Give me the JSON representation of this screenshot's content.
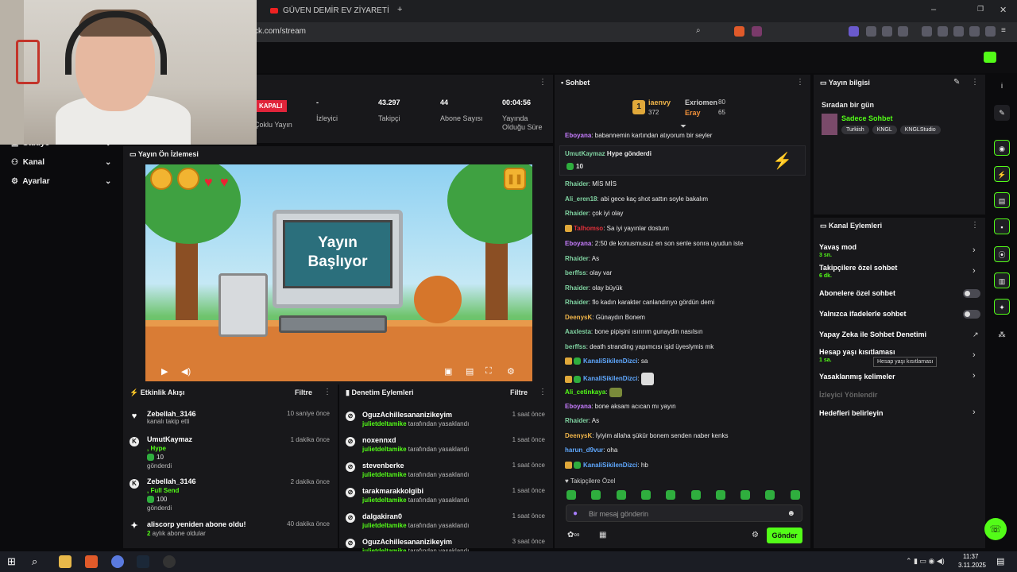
{
  "browser": {
    "tab_title": "GÜVEN DEMİR EV ZİYARETİ - YouTub",
    "new_tab": "+",
    "url": "ck.com/stream",
    "win_min": "–",
    "win_max": "❐",
    "win_close": "✕"
  },
  "nav": {
    "studio": "Stüdyo",
    "kanal": "Kanal",
    "ayarlar": "Ayarlar"
  },
  "stats": {
    "badge": "KAPALI",
    "items": [
      {
        "value": "",
        "label": "Çoklu Yayın"
      },
      {
        "value": "-",
        "label": "İzleyici"
      },
      {
        "value": "43.297",
        "label": "Takipçi"
      },
      {
        "value": "44",
        "label": "Abone Sayısı"
      },
      {
        "value": "00:04:56",
        "label": "Yayında Olduğu Süre"
      }
    ]
  },
  "preview": {
    "title": "Yayın Ön İzlemesi",
    "screen_text_1": "Yayın",
    "screen_text_2": "Başlıyor"
  },
  "activity": {
    "title": "Etkinlik Akışı",
    "filter": "Filtre",
    "rows": [
      {
        "name": "Zebellah_3146",
        "time": "10 saniye önce",
        "sub": "kanalı takip etti"
      },
      {
        "name": "UmutKaymaz",
        "time": "1 dakika önce",
        "extra": ", Hype",
        "amount": "10",
        "sub": "gönderdi"
      },
      {
        "name": "Zebellah_3146",
        "time": "2 dakika önce",
        "extra": ", Full Send",
        "amount": "100",
        "sub": "gönderdi"
      },
      {
        "name": "aliscorp yeniden abone oldu!",
        "time": "40 dakika önce",
        "sub_num": "2",
        "sub": " aylık abone oldular"
      }
    ]
  },
  "moderation": {
    "title": "Denetim Eylemleri",
    "filter": "Filtre",
    "by": "julietdeltamike",
    "action": " tarafından yasaklandı",
    "rows": [
      {
        "name": "OguzAchillesananizikeyim",
        "time": "1 saat önce"
      },
      {
        "name": "noxennxd",
        "time": "1 saat önce"
      },
      {
        "name": "stevenberke",
        "time": "1 saat önce"
      },
      {
        "name": "tarakmarakkolgibi",
        "time": "1 saat önce"
      },
      {
        "name": "dalgakiran0",
        "time": "1 saat önce"
      },
      {
        "name": "OguzAchillesananizikeyim",
        "time": "3 saat önce"
      }
    ]
  },
  "chat": {
    "title": "Sohbet",
    "leader_rank": "1",
    "leader_name": "iaenvy",
    "leader_pts": "372",
    "second_name": "Exriomen",
    "second_pts": "80",
    "third_name": "Eray",
    "third_pts": "65",
    "hype_user": "UmutKaymaz",
    "hype_text": " Hype gönderdi",
    "hype_amount": "10",
    "messages": [
      {
        "user": "Eboyana",
        "color": "#c77dff",
        "text": ": babannemin kartından atıyorum bir seyler"
      },
      {
        "user": "Rhaider",
        "color": "#7fd1a0",
        "text": ": MİS MİS"
      },
      {
        "user": "Ali_eren18",
        "color": "#7fd1a0",
        "text": ": abi gece kaç shot sattın soyle bakalım"
      },
      {
        "user": "Rhaider",
        "color": "#7fd1a0",
        "text": ": çok iyi olay"
      },
      {
        "user": "Talhomso",
        "color": "#e0303a",
        "text": ": Sa iyi yayınlar dostum"
      },
      {
        "user": "Eboyana",
        "color": "#c77dff",
        "text": ": 2:50 de konusmusuz en son senle sonra uyudun iste"
      },
      {
        "user": "Rhaider",
        "color": "#7fd1a0",
        "text": ": As"
      },
      {
        "user": "berffss",
        "color": "#7fd1a0",
        "text": ": olay var"
      },
      {
        "user": "Rhaider",
        "color": "#7fd1a0",
        "text": ": olay büyük"
      },
      {
        "user": "Rhaider",
        "color": "#7fd1a0",
        "text": ": flo kadın karakter canlandırıyo gördün demi"
      },
      {
        "user": "DeenysK",
        "color": "#f0b54a",
        "text": ": Günaydın Bonem"
      },
      {
        "user": "Aaxlesta",
        "color": "#7fd1a0",
        "text": ": bone pipişini ısırırım gunaydin nasılsın"
      },
      {
        "user": "berffss",
        "color": "#7fd1a0",
        "text": ": death stranding yapımcısı işid üyeslymis mk"
      },
      {
        "user": "KanaliSikilenDizci",
        "color": "#5fa8ff",
        "text": ": sa"
      },
      {
        "user": "KanaliSikilenDizci",
        "color": "#5fa8ff",
        "text": ":"
      },
      {
        "user": "Ali_cetinkaya",
        "color": "#53fc18",
        "text": ":"
      },
      {
        "user": "Eboyana",
        "color": "#c77dff",
        "text": ": bone aksam acıcan mı yayın"
      },
      {
        "user": "Rhaider",
        "color": "#7fd1a0",
        "text": ": As"
      },
      {
        "user": "DeenysK",
        "color": "#f0b54a",
        "text": ": İyiyim allaha şükür bonem senden naber kenks"
      },
      {
        "user": "harun_d9vur",
        "color": "#5fa8ff",
        "text": ": oha"
      },
      {
        "user": "KanaliSikilenDizci",
        "color": "#5fa8ff",
        "text": ": hb"
      }
    ],
    "followers_only": "Takipçilere Özel",
    "placeholder": "Bir mesaj gönderin",
    "send": "Gönder"
  },
  "stream_info": {
    "title": "Yayın bilgisi",
    "next": "Sıradan bir gün",
    "category": "Sadece Sohbet",
    "tags": [
      "Turkish",
      "KNGL",
      "KNGLStudio"
    ]
  },
  "channel_actions": {
    "title": "Kanal Eylemleri",
    "slow_mode": "Yavaş mod",
    "slow_mode_val": "3 sn.",
    "followers_chat": "Takipçilere özel sohbet",
    "followers_chat_val": "6 dk.",
    "subs_chat": "Abonelere özel sohbet",
    "emote_chat": "Yalnızca ifadelerle sohbet",
    "ai_mod": "Yapay Zeka ile Sohbet Denetimi",
    "age_limit": "Hesap yaşı kısıtlaması",
    "age_limit_val": "1 sa.",
    "tooltip": "Hesap yaşı kısıtlaması",
    "banned_words": "Yasaklanmış kelimeler",
    "raid": "İzleyici Yönlendir",
    "goals": "Hedefleri belirleyin"
  },
  "taskbar": {
    "time": "11:37",
    "date": "3.11.2025"
  },
  "colors": {
    "accent": "#53fc18",
    "panel": "#18181b",
    "bg": "#0b0b0d"
  }
}
